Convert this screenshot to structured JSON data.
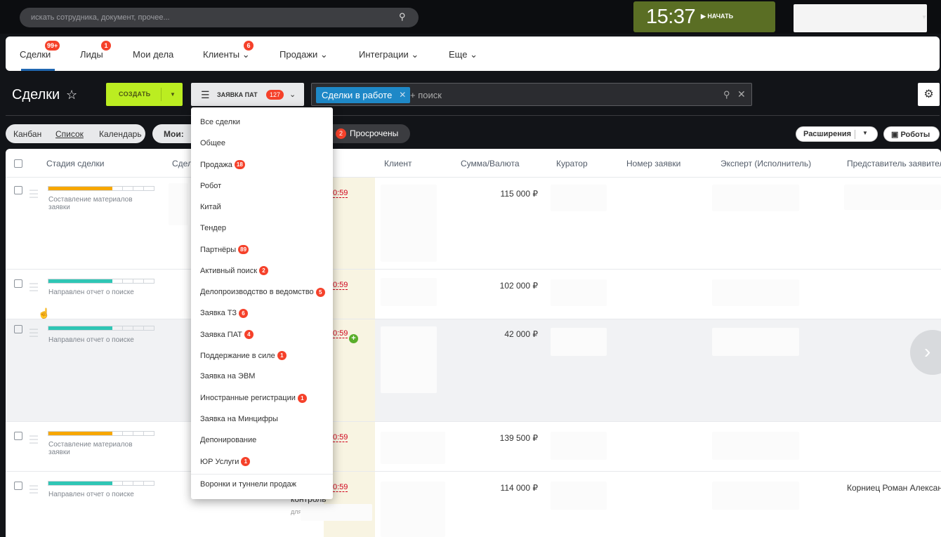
{
  "topbar": {
    "search_placeholder": "искать сотрудника, документ, прочее...",
    "clock_time": "15:37",
    "start_label": "НАЧАТЬ"
  },
  "nav": {
    "items": [
      {
        "label": "Сделки",
        "badge": "99+"
      },
      {
        "label": "Лиды",
        "badge": "1"
      },
      {
        "label": "Мои дела",
        "badge": ""
      },
      {
        "label": "Клиенты",
        "badge": "6"
      },
      {
        "label": "Продажи",
        "badge": ""
      },
      {
        "label": "Интеграции",
        "badge": ""
      },
      {
        "label": "Еще",
        "badge": ""
      }
    ]
  },
  "header": {
    "title": "Сделки",
    "create_label": "СОЗДАТЬ",
    "filter_label": "ЗАЯВКА ПАТ",
    "filter_count": "127",
    "search_tag": "Сделки в работе",
    "search_placeholder": "+ поиск"
  },
  "toolbar": {
    "views": [
      "Канбан",
      "Список",
      "Календарь"
    ],
    "mine_label": "Мои:",
    "overdue_count": "2",
    "overdue_label": "Просрочены",
    "extensions_label": "Расширения",
    "robots_label": "Роботы"
  },
  "table": {
    "columns": [
      "Стадия сделки",
      "Сдел",
      "Клиент",
      "Сумма/Валюта",
      "Куратор",
      "Номер заявки",
      "Эксперт (Исполнитель)",
      "Представитель заявителя"
    ],
    "rows": [
      {
        "stage": "Составление материалов заявки",
        "stage_progress": 0.6,
        "stage_color": "#f7a700",
        "time": "0:59",
        "sum": "115 000 ₽",
        "rep": ""
      },
      {
        "stage": "Направлен отчет о поиске",
        "stage_progress": 0.55,
        "stage_color": "#2fc6b5",
        "time": "0:59",
        "sum": "102 000 ₽",
        "rep": ""
      },
      {
        "stage": "Направлен отчет о поиске",
        "stage_progress": 0.55,
        "stage_color": "#2fc6b5",
        "time": "0:59",
        "sum": "42 000 ₽",
        "rep": ""
      },
      {
        "stage": "Составление материалов заявки",
        "stage_progress": 0.6,
        "stage_color": "#f7a700",
        "time": "0:59",
        "sum": "139 500 ₽",
        "rep": ""
      },
      {
        "stage": "Направлен отчет о поиске",
        "stage_progress": 0.55,
        "stage_color": "#2fc6b5",
        "time": "0:59",
        "sum": "114 000 ₽",
        "rep": "Корниец Роман Алексан"
      }
    ],
    "control_text": "контроль",
    "for_text": "для"
  },
  "dropdown": {
    "items": [
      {
        "label": "Все сделки",
        "badge": ""
      },
      {
        "label": "Общее",
        "badge": ""
      },
      {
        "label": "Продажа",
        "badge": "18"
      },
      {
        "label": "Робот",
        "badge": ""
      },
      {
        "label": "Китай",
        "badge": ""
      },
      {
        "label": "Тендер",
        "badge": ""
      },
      {
        "label": "Партнёры",
        "badge": "89"
      },
      {
        "label": "Активный поиск",
        "badge": "2"
      },
      {
        "label": "Делопроизводство в ведомство",
        "badge": "5"
      },
      {
        "label": "Заявка ТЗ",
        "badge": "6"
      },
      {
        "label": "Заявка ПАТ",
        "badge": "4"
      },
      {
        "label": "Поддержание в силе",
        "badge": "1"
      },
      {
        "label": "Заявка на ЭВМ",
        "badge": ""
      },
      {
        "label": "Иностранные регистрации",
        "badge": "1"
      },
      {
        "label": "Заявка на Минцифры",
        "badge": ""
      },
      {
        "label": "Депонирование",
        "badge": ""
      },
      {
        "label": "ЮР Услуги",
        "badge": "1"
      }
    ],
    "footer": "Воронки и туннели продаж"
  }
}
